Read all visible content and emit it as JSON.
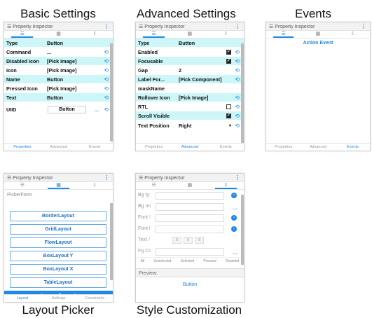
{
  "captions": {
    "basic": "Basic Settings",
    "advanced": "Advanced Settings",
    "events": "Events",
    "layout": "Layout Picker",
    "style": "Style Customization"
  },
  "panel_header": "Property Inspector",
  "bottom_tabs": [
    "Properties",
    "Advanced",
    "Events"
  ],
  "layout_bottom_tabs": [
    "Layout",
    "Settings",
    "Constraints"
  ],
  "basic": {
    "rows": [
      {
        "key": "Type",
        "value": "Button"
      },
      {
        "key": "Command",
        "value": "..."
      },
      {
        "key": "Disabled Icon",
        "value": "[Pick Image]"
      },
      {
        "key": "Icon",
        "value": "[Pick Image]"
      },
      {
        "key": "Name",
        "value": "Button"
      },
      {
        "key": "Pressed Icon",
        "value": "[Pick Image]"
      },
      {
        "key": "Text",
        "value": "Button"
      }
    ],
    "uiid_key": "UIID",
    "uiid_value": "Button",
    "uiid_more": "..."
  },
  "advanced": {
    "rows": [
      {
        "key": "Type",
        "value": "Button"
      },
      {
        "key": "Enabled",
        "value": ""
      },
      {
        "key": "Focusable",
        "value": ""
      },
      {
        "key": "Gap",
        "value": "2"
      },
      {
        "key": "Label For...",
        "value": "[Pick Component]"
      },
      {
        "key": "maskName",
        "value": ""
      },
      {
        "key": "Rollover Icon",
        "value": "[Pick Image]"
      },
      {
        "key": "RTL",
        "value": ""
      },
      {
        "key": "Scroll Visible",
        "value": ""
      },
      {
        "key": "Text Position",
        "value": "Right"
      }
    ]
  },
  "events": {
    "action": "Action Event"
  },
  "layout": {
    "label": "PickerForm",
    "options": [
      "BorderLayout",
      "GridLayout",
      "FlowLayout",
      "BoxLayout Y",
      "BoxLayout X",
      "TableLayout",
      "LayeredLayout"
    ],
    "selected": "LayeredLayout"
  },
  "style": {
    "rows": [
      "Bg ty:",
      "Bg Im",
      "Font !",
      "Font l",
      "Text /",
      "Fg Cc"
    ],
    "states": [
      "All",
      "Unselected",
      "Selected",
      "Pressed",
      "Disabled"
    ],
    "preview_label": "Preview:",
    "preview_button": "Button"
  }
}
